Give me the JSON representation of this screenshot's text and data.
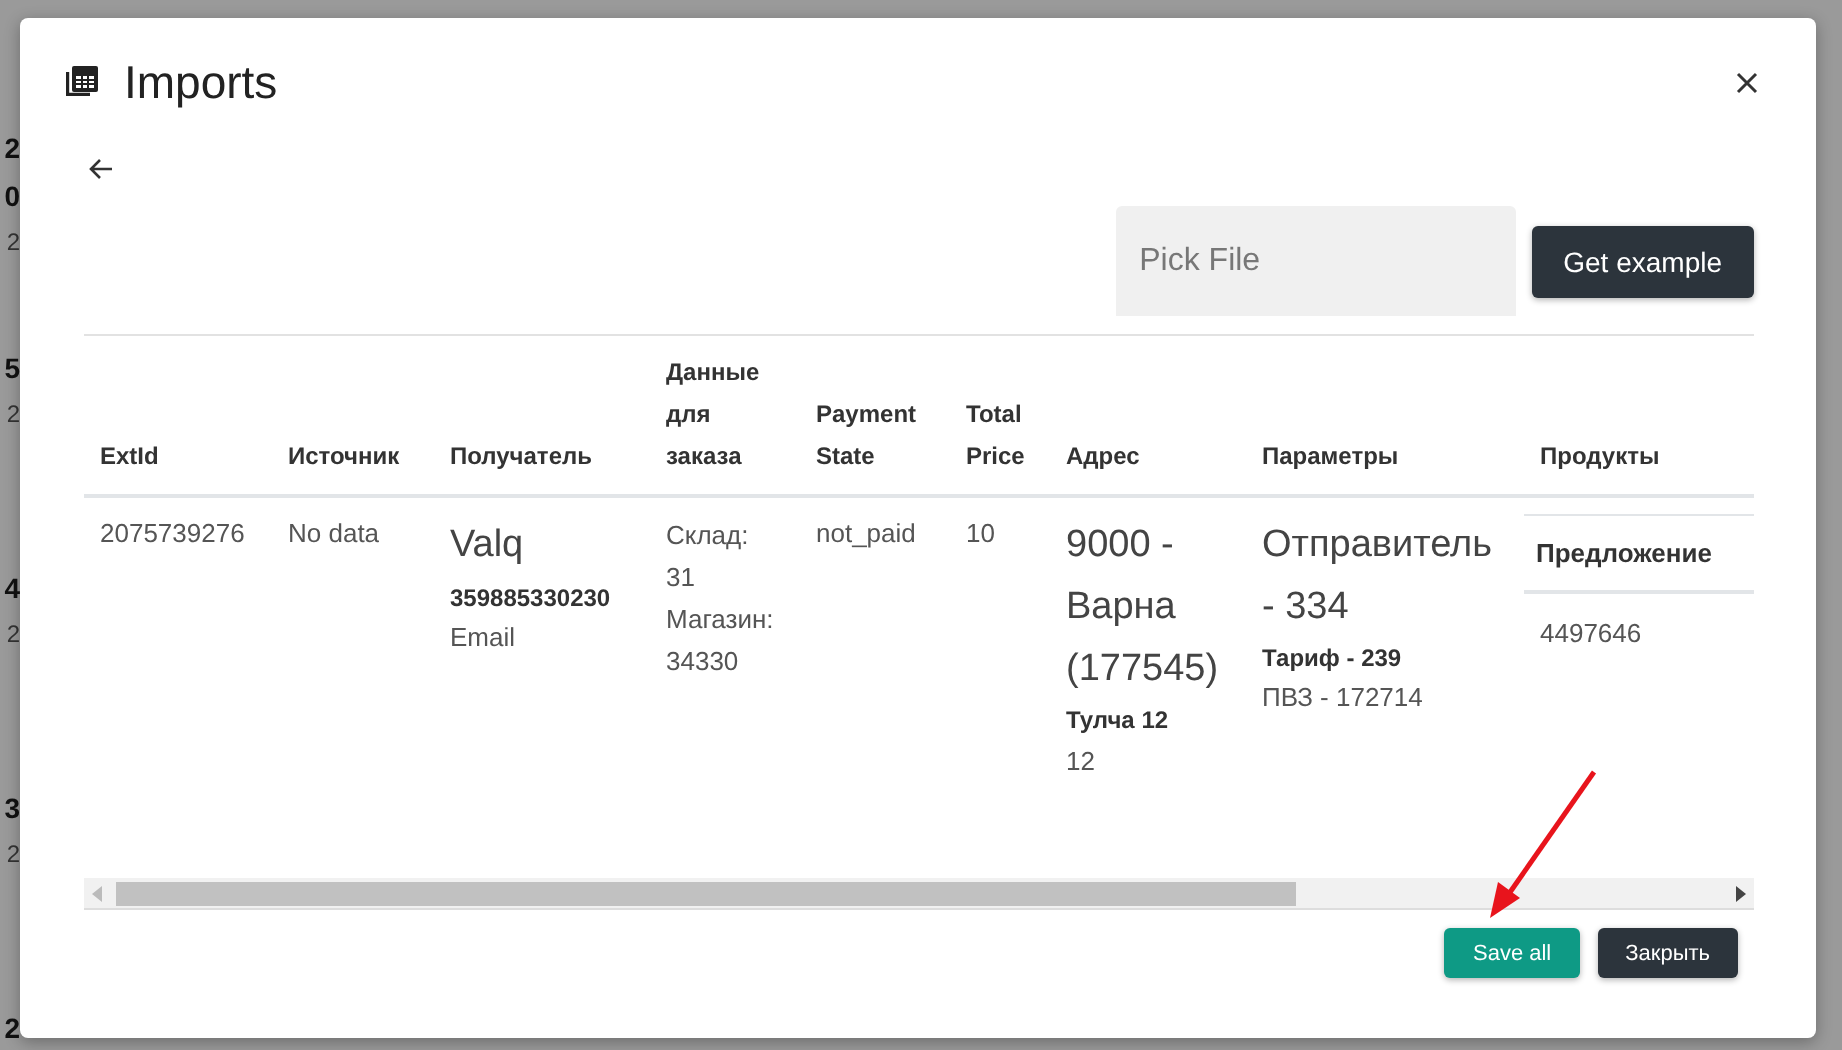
{
  "background": {
    "groups": [
      {
        "id": "2",
        "lines": [
          "0",
          "2"
        ]
      },
      {
        "id": "5",
        "lines": [
          "2"
        ]
      },
      {
        "id": "4",
        "lines": [
          "2"
        ]
      },
      {
        "id": "3",
        "lines": [
          "2"
        ]
      },
      {
        "id": "2"
      }
    ]
  },
  "dialog": {
    "title": "Imports",
    "file_field": {
      "placeholder": "Pick File"
    },
    "example_button": "Get example",
    "table": {
      "columns": [
        "ExtId",
        "Источник",
        "Получатель",
        "Данные для заказа",
        "Payment State",
        "Total Price",
        "Адрес",
        "Параметры",
        "Продукты"
      ],
      "rows": [
        {
          "ext_id": "2075739276",
          "source": "No data",
          "recipient": {
            "name": "Valq",
            "phone": "359885330230",
            "email": "Email"
          },
          "order_data": [
            "Склад:",
            "31",
            "Магазин:",
            "34330"
          ],
          "payment_state": "not_paid",
          "total_price": "10",
          "address": {
            "main": "9000 - Варна (177545)",
            "street": "Тулча 12",
            "number": "12"
          },
          "parameters": {
            "sender": "Отправитель - 334",
            "tariff": "Тариф - 239",
            "pickup": "ПВЗ - 172714"
          },
          "products": {
            "columns": [
              "Предложение"
            ],
            "rows": [
              [
                "4497646"
              ]
            ]
          }
        }
      ]
    },
    "buttons": [
      {
        "label": "Save all",
        "kind": "primary"
      },
      {
        "label": "Закрыть",
        "kind": "secondary"
      }
    ]
  }
}
